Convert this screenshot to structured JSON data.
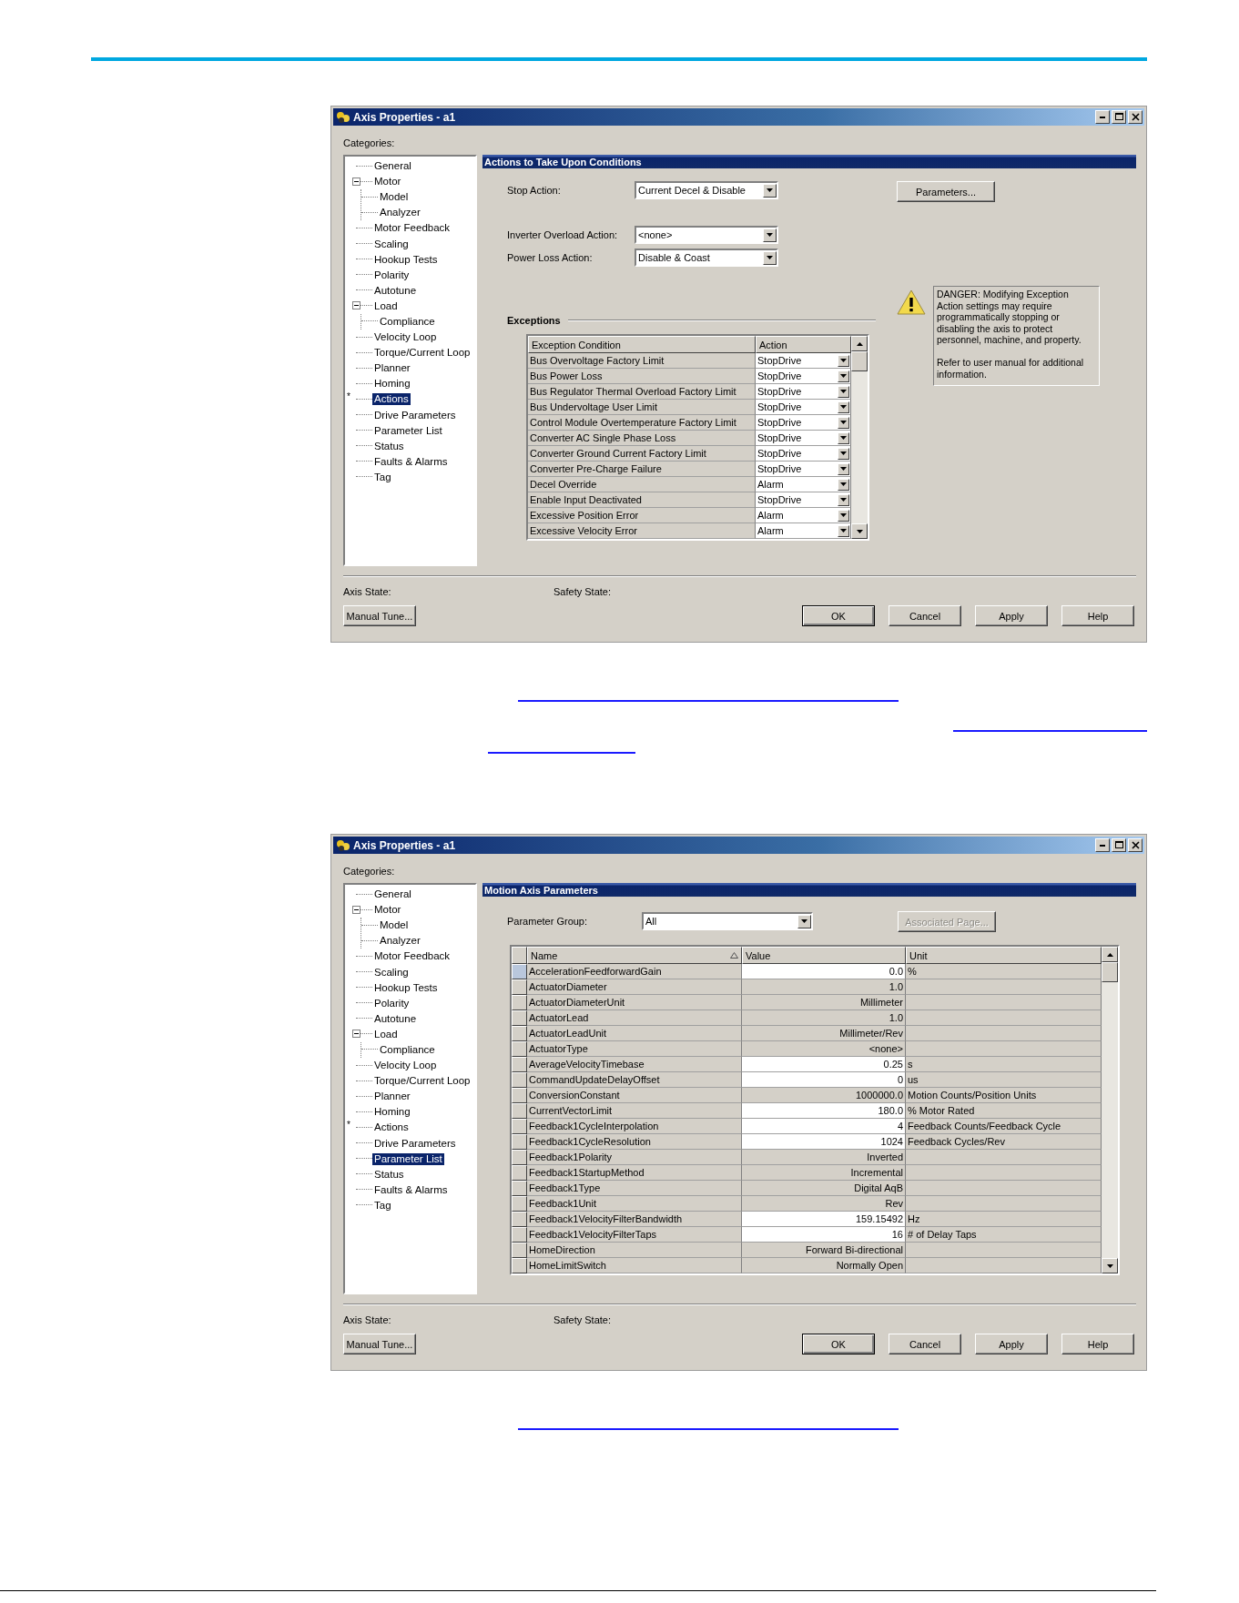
{
  "windows": [
    {
      "title": "Axis Properties - a1",
      "categories_label": "Categories:",
      "tree": [
        {
          "label": "General",
          "selected": false
        },
        {
          "label": "Motor",
          "selected": false,
          "expanded": true,
          "children": [
            {
              "label": "Model",
              "selected": false
            },
            {
              "label": "Analyzer",
              "selected": false
            }
          ]
        },
        {
          "label": "Motor Feedback",
          "selected": false
        },
        {
          "label": "Scaling",
          "selected": false
        },
        {
          "label": "Hookup Tests",
          "selected": false
        },
        {
          "label": "Polarity",
          "selected": false
        },
        {
          "label": "Autotune",
          "selected": false
        },
        {
          "label": "Load",
          "selected": false,
          "expanded": true,
          "children": [
            {
              "label": "Compliance",
              "selected": false
            }
          ]
        },
        {
          "label": "Velocity Loop",
          "selected": false
        },
        {
          "label": "Torque/Current Loop",
          "selected": false
        },
        {
          "label": "Planner",
          "selected": false
        },
        {
          "label": "Homing",
          "selected": false
        },
        {
          "label": "Actions",
          "selected": true,
          "flag": "*"
        },
        {
          "label": "Drive Parameters",
          "selected": false
        },
        {
          "label": "Parameter List",
          "selected": false
        },
        {
          "label": "Status",
          "selected": false
        },
        {
          "label": "Faults & Alarms",
          "selected": false
        },
        {
          "label": "Tag",
          "selected": false
        }
      ],
      "panel": {
        "kind": "actions",
        "title": "Actions to Take Upon Conditions",
        "field_groups": [
          [
            {
              "label": "Stop Action:",
              "value": "Current Decel & Disable"
            }
          ],
          [
            {
              "label": "Inverter Overload Action:",
              "value": "<none>"
            },
            {
              "label": "Power Loss Action:",
              "value": "Disable & Coast"
            }
          ]
        ],
        "side_button": {
          "label": "Parameters...",
          "disabled": false
        },
        "warning": {
          "text": "DANGER: Modifying Exception Action settings may require programmatically stopping or disabling the axis to protect personnel, machine, and property.",
          "note": "Refer to user manual for additional information."
        },
        "exceptions": {
          "title": "Exceptions",
          "columns": [
            "Exception Condition",
            "Action"
          ],
          "rows": [
            {
              "condition": "Bus Overvoltage Factory Limit",
              "action": "StopDrive"
            },
            {
              "condition": "Bus Power Loss",
              "action": "StopDrive"
            },
            {
              "condition": "Bus Regulator Thermal Overload Factory Limit",
              "action": "StopDrive"
            },
            {
              "condition": "Bus Undervoltage User Limit",
              "action": "StopDrive"
            },
            {
              "condition": "Control Module Overtemperature Factory Limit",
              "action": "StopDrive"
            },
            {
              "condition": "Converter AC Single Phase Loss",
              "action": "StopDrive"
            },
            {
              "condition": "Converter Ground Current Factory Limit",
              "action": "StopDrive"
            },
            {
              "condition": "Converter Pre-Charge Failure",
              "action": "StopDrive"
            },
            {
              "condition": "Decel Override",
              "action": "Alarm"
            },
            {
              "condition": "Enable Input Deactivated",
              "action": "StopDrive"
            },
            {
              "condition": "Excessive Position Error",
              "action": "Alarm"
            },
            {
              "condition": "Excessive Velocity Error",
              "action": "Alarm"
            }
          ]
        }
      },
      "status": [
        "Axis State:",
        "Safety State:"
      ],
      "buttons": [
        {
          "label": "Manual Tune...",
          "default": false
        },
        {
          "label": "OK",
          "default": true
        },
        {
          "label": "Cancel",
          "default": false
        },
        {
          "label": "Apply",
          "default": false
        },
        {
          "label": "Help",
          "default": false
        }
      ]
    },
    {
      "title": "Axis Properties - a1",
      "categories_label": "Categories:",
      "tree": [
        {
          "label": "General",
          "selected": false
        },
        {
          "label": "Motor",
          "selected": false,
          "expanded": true,
          "children": [
            {
              "label": "Model",
              "selected": false
            },
            {
              "label": "Analyzer",
              "selected": false
            }
          ]
        },
        {
          "label": "Motor Feedback",
          "selected": false
        },
        {
          "label": "Scaling",
          "selected": false
        },
        {
          "label": "Hookup Tests",
          "selected": false
        },
        {
          "label": "Polarity",
          "selected": false
        },
        {
          "label": "Autotune",
          "selected": false
        },
        {
          "label": "Load",
          "selected": false,
          "expanded": true,
          "children": [
            {
              "label": "Compliance",
              "selected": false
            }
          ]
        },
        {
          "label": "Velocity Loop",
          "selected": false
        },
        {
          "label": "Torque/Current Loop",
          "selected": false
        },
        {
          "label": "Planner",
          "selected": false
        },
        {
          "label": "Homing",
          "selected": false
        },
        {
          "label": "Actions",
          "selected": false,
          "flag": "*"
        },
        {
          "label": "Drive Parameters",
          "selected": false
        },
        {
          "label": "Parameter List",
          "selected": true
        },
        {
          "label": "Status",
          "selected": false
        },
        {
          "label": "Faults & Alarms",
          "selected": false
        },
        {
          "label": "Tag",
          "selected": false
        }
      ],
      "panel": {
        "kind": "parameters",
        "title": "Motion Axis Parameters",
        "group": {
          "label": "Parameter Group:",
          "value": "All"
        },
        "side_button": {
          "label": "Associated Page...",
          "disabled": true
        },
        "grid": {
          "columns": [
            {
              "label": "Name",
              "sorted": true
            },
            {
              "label": "Value",
              "sorted": false
            },
            {
              "label": "Unit",
              "sorted": false
            }
          ],
          "rows": [
            {
              "name": "AccelerationFeedforwardGain",
              "value": "0.0",
              "unit": "%",
              "editable": true,
              "selected": true
            },
            {
              "name": "ActuatorDiameter",
              "value": "1.0",
              "editable": false,
              "selected": false
            },
            {
              "name": "ActuatorDiameterUnit",
              "value": "Millimeter",
              "editable": false,
              "selected": false
            },
            {
              "name": "ActuatorLead",
              "value": "1.0",
              "editable": false,
              "selected": false
            },
            {
              "name": "ActuatorLeadUnit",
              "value": "Millimeter/Rev",
              "editable": false,
              "selected": false
            },
            {
              "name": "ActuatorType",
              "value": "<none>",
              "editable": false,
              "selected": false
            },
            {
              "name": "AverageVelocityTimebase",
              "value": "0.25",
              "unit": "s",
              "editable": true,
              "selected": false
            },
            {
              "name": "CommandUpdateDelayOffset",
              "value": "0",
              "unit": "us",
              "editable": true,
              "selected": false
            },
            {
              "name": "ConversionConstant",
              "value": "1000000.0",
              "unit": "Motion Counts/Position Units",
              "editable": false,
              "selected": false
            },
            {
              "name": "CurrentVectorLimit",
              "value": "180.0",
              "unit": "% Motor Rated",
              "editable": true,
              "selected": false
            },
            {
              "name": "Feedback1CycleInterpolation",
              "value": "4",
              "unit": "Feedback Counts/Feedback Cycle",
              "editable": true,
              "selected": false
            },
            {
              "name": "Feedback1CycleResolution",
              "value": "1024",
              "unit": "Feedback Cycles/Rev",
              "editable": true,
              "selected": false
            },
            {
              "name": "Feedback1Polarity",
              "value": "Inverted",
              "editable": false,
              "selected": false
            },
            {
              "name": "Feedback1StartupMethod",
              "value": "Incremental",
              "editable": false,
              "selected": false
            },
            {
              "name": "Feedback1Type",
              "value": "Digital AqB",
              "editable": false,
              "selected": false
            },
            {
              "name": "Feedback1Unit",
              "value": "Rev",
              "editable": false,
              "selected": false
            },
            {
              "name": "Feedback1VelocityFilterBandwidth",
              "value": "159.15492",
              "unit": "Hz",
              "editable": true,
              "selected": false
            },
            {
              "name": "Feedback1VelocityFilterTaps",
              "value": "16",
              "unit": "# of Delay Taps",
              "editable": true,
              "selected": false
            },
            {
              "name": "HomeDirection",
              "value": "Forward Bi-directional",
              "editable": false,
              "selected": false
            },
            {
              "name": "HomeLimitSwitch",
              "value": "Normally Open",
              "editable": false,
              "selected": false
            }
          ]
        }
      },
      "status": [
        "Axis State:",
        "Safety State:"
      ],
      "buttons": [
        {
          "label": "Manual Tune...",
          "default": false
        },
        {
          "label": "OK",
          "default": true
        },
        {
          "label": "Cancel",
          "default": false
        },
        {
          "label": "Apply",
          "default": false
        },
        {
          "label": "Help",
          "default": false
        }
      ]
    }
  ]
}
